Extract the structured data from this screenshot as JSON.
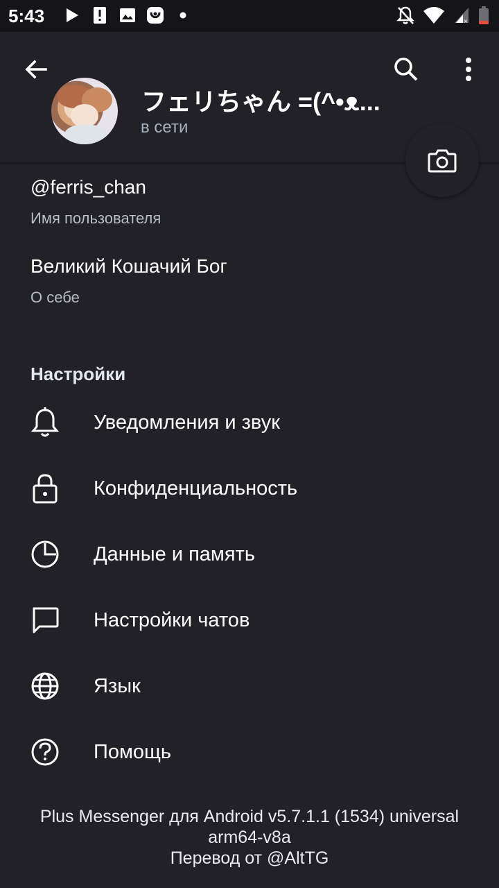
{
  "status_bar": {
    "time": "5:43",
    "left_icons": [
      "play-icon",
      "alert-icon",
      "image-icon",
      "app-icon",
      "dot-icon"
    ],
    "right_icons": [
      "notifications-off-icon",
      "wifi-icon",
      "signal-icon",
      "battery-icon"
    ]
  },
  "header": {
    "name": "フェリちゃん =(^•ᴥ...",
    "status": "в сети"
  },
  "info": {
    "username": "@ferris_chan",
    "username_label": "Имя пользователя",
    "bio": "Великий Кошачий Бог",
    "bio_label": "О себе"
  },
  "settings": {
    "title": "Настройки",
    "items": [
      {
        "label": "Уведомления и звук",
        "icon": "bell-icon"
      },
      {
        "label": "Конфиденциальность",
        "icon": "lock-icon"
      },
      {
        "label": "Данные и память",
        "icon": "pie-chart-icon"
      },
      {
        "label": "Настройки чатов",
        "icon": "chat-bubble-icon"
      },
      {
        "label": "Язык",
        "icon": "globe-icon"
      },
      {
        "label": "Помощь",
        "icon": "help-icon"
      }
    ]
  },
  "footer": {
    "line1": "Plus Messenger для Android v5.7.1.1 (1534) universal",
    "line2": "arm64-v8a",
    "line3": "Перевод от @AltTG"
  },
  "colors": {
    "background": "#222128",
    "status_bar": "#151418",
    "online_status": "#a7b2c0",
    "battery_warning": "#e84c3d"
  }
}
